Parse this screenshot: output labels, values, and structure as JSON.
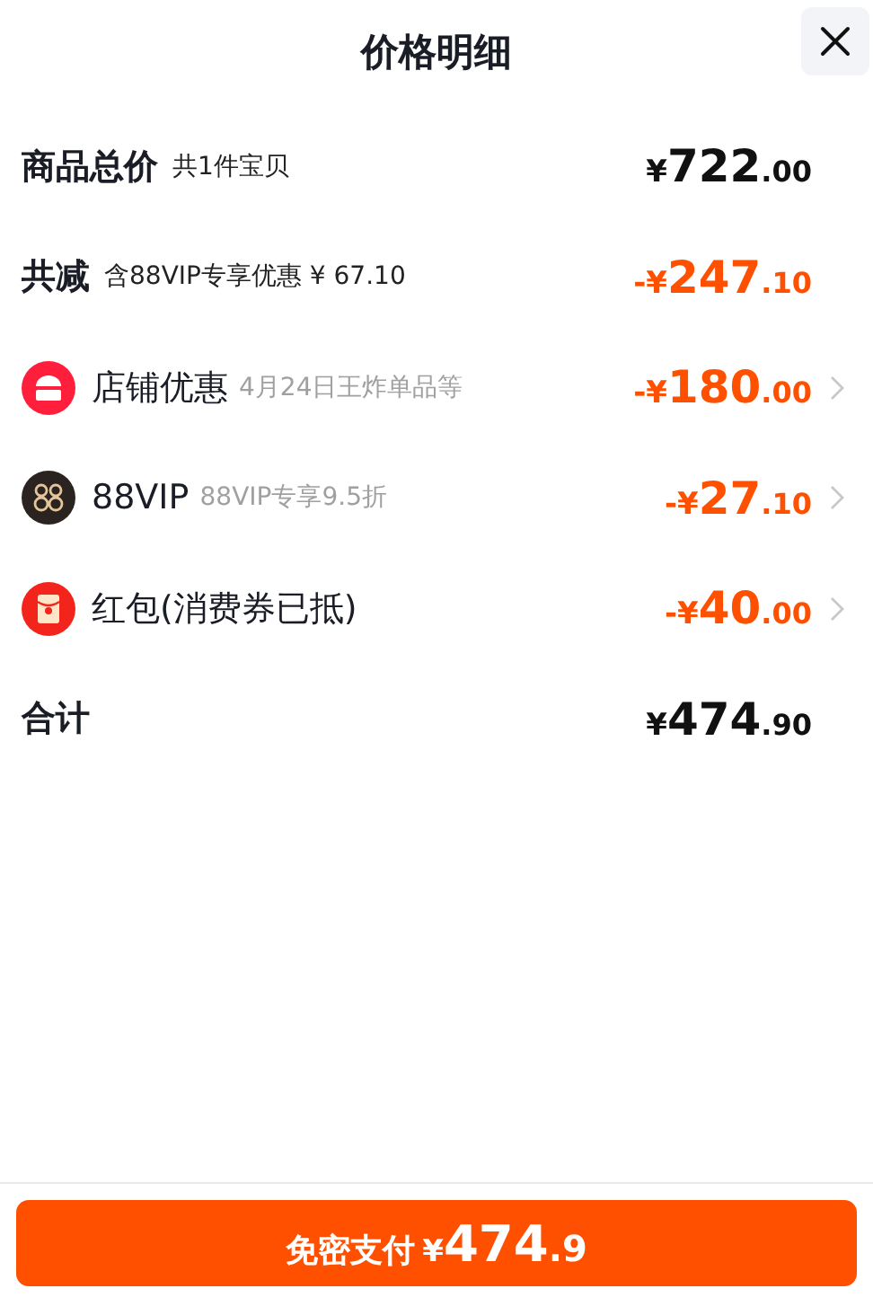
{
  "title": "价格明细",
  "rows": [
    {
      "kind": "subtotal",
      "label": "商品总价",
      "note": "共1件宝贝",
      "price": {
        "prefix": "¥",
        "integer": "722",
        "decimal": ".00"
      }
    },
    {
      "kind": "reduction",
      "label": "共减",
      "note": "含88VIP专享优惠 ¥ 67.10",
      "price": {
        "prefix": "-¥",
        "integer": "247",
        "decimal": ".10"
      }
    },
    {
      "kind": "shop",
      "label": "店铺优惠",
      "note": "4月24日王炸单品等",
      "price": {
        "prefix": "-¥",
        "integer": "180",
        "decimal": ".00"
      }
    },
    {
      "kind": "vip",
      "label": "88VIP",
      "note": "88VIP专享9.5折",
      "price": {
        "prefix": "-¥",
        "integer": "27",
        "decimal": ".10"
      }
    },
    {
      "kind": "coupon",
      "label": "红包(消费券已抵)",
      "price": {
        "prefix": "-¥",
        "integer": "40",
        "decimal": ".00"
      }
    },
    {
      "kind": "total",
      "label": "合计",
      "price": {
        "prefix": "¥",
        "integer": "474",
        "decimal": ".90"
      }
    }
  ],
  "pay_button": {
    "label": "免密支付",
    "prefix": "¥",
    "integer": "474",
    "decimal": ".9"
  }
}
